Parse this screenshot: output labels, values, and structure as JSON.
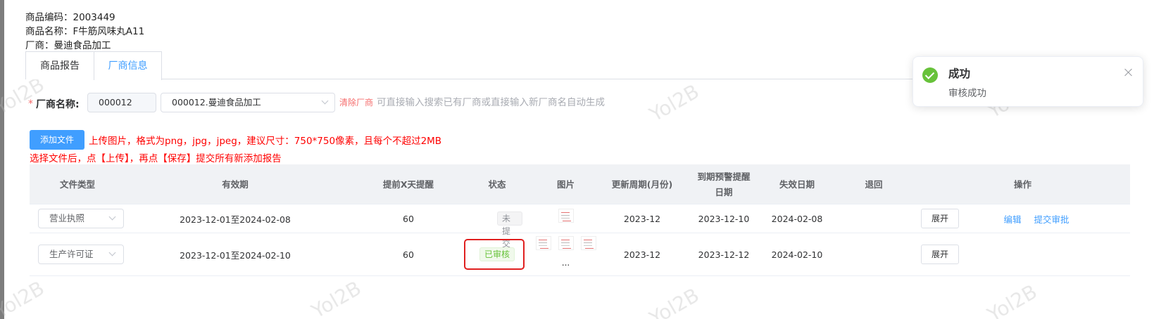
{
  "product": {
    "code_label": "商品编码：",
    "code_value": "2003449",
    "name_label": "商品名称：",
    "name_value": "F牛筋风味丸A11",
    "vendor_label": "厂商：",
    "vendor_value": "曼迪食品加工"
  },
  "tabs": [
    {
      "label": "商品报告",
      "active": false
    },
    {
      "label": "厂商信息",
      "active": true
    }
  ],
  "vendor_form": {
    "required_mark": "*",
    "label": "厂商名称:",
    "code": "000012",
    "selected": "000012.曼迪食品加工",
    "clear_label": "清除厂商",
    "hint": "可直接输入搜索已有厂商或直接输入新厂商名自动生成"
  },
  "upload": {
    "button_label": "添加文件",
    "tip1": "上传图片，格式为png，jpg，jpeg，建议尺寸：750*750像素，且每个不超过2MB",
    "tip2": "选择文件后，点【上传】，再点【保存】提交所有新添加报告"
  },
  "table": {
    "headers": [
      "文件类型",
      "有效期",
      "提前X天提醒",
      "状态",
      "图片",
      "更新周期(月份)",
      "到期预警提醒日期",
      "失效日期",
      "退回",
      "操作"
    ],
    "rows": [
      {
        "type": "营业执照",
        "validity": "2023-12-01至2024-02-08",
        "remind_days": "60",
        "status": "未提交",
        "update_cycle": "2023-12",
        "warn_date": "2023-12-10",
        "expire_date": "2024-02-08",
        "returned": "",
        "expand": "展开",
        "edit": "编辑",
        "submit": "提交审批"
      },
      {
        "type": "生产许可证",
        "validity": "2023-12-01至2024-02-10",
        "remind_days": "60",
        "status": "已审核",
        "images_more": "...",
        "update_cycle": "2023-12",
        "warn_date": "2023-12-12",
        "expire_date": "2024-02-10",
        "returned": "",
        "expand": "展开"
      }
    ]
  },
  "toast": {
    "title": "成功",
    "message": "审核成功",
    "icon": "success-check-icon"
  },
  "watermark": "Yol2B",
  "colors": {
    "primary": "#409eff",
    "success": "#67c23a",
    "danger": "#f56c6c",
    "highlight": "#e02020"
  }
}
